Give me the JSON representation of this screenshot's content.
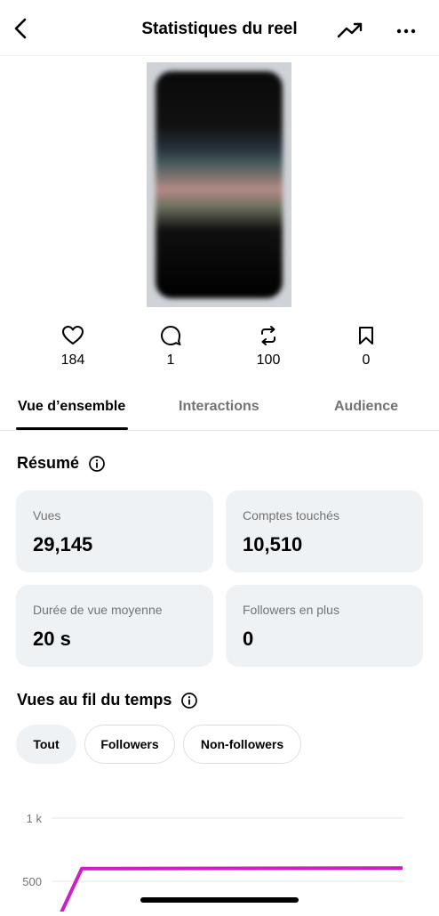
{
  "header": {
    "title": "Statistiques du reel",
    "back_icon": "chevron-left-icon",
    "trend_icon": "trending-up-icon",
    "more_icon": "more-horizontal-icon"
  },
  "thumbnail": {
    "alt": "blurred-reel-thumbnail"
  },
  "stats": [
    {
      "icon": "heart-icon",
      "value": "184"
    },
    {
      "icon": "comment-icon",
      "value": "1"
    },
    {
      "icon": "repost-icon",
      "value": "100"
    },
    {
      "icon": "bookmark-icon",
      "value": "0"
    }
  ],
  "tabs": [
    {
      "label": "Vue d’ensemble",
      "active": true
    },
    {
      "label": "Interactions",
      "active": false
    },
    {
      "label": "Audience",
      "active": false
    }
  ],
  "summary": {
    "title": "Résumé",
    "cards": [
      {
        "label": "Vues",
        "value": "29,145"
      },
      {
        "label": "Comptes touchés",
        "value": "10,510"
      },
      {
        "label": "Durée de vue moyenne",
        "value": "20 s"
      },
      {
        "label": "Followers en plus",
        "value": "0"
      }
    ]
  },
  "views_over_time": {
    "title": "Vues au fil du temps",
    "filters": [
      {
        "label": "Tout",
        "active": true
      },
      {
        "label": "Followers",
        "active": false
      },
      {
        "label": "Non-followers",
        "active": false
      }
    ]
  },
  "chart_data": {
    "type": "line",
    "y_tick_labels": [
      "1 k",
      "500"
    ],
    "y_ticks": [
      1000,
      500
    ],
    "ylim": [
      0,
      1000
    ],
    "series": [
      {
        "color": "#d21cc8",
        "x": [
          0,
          1,
          2
        ],
        "y": [
          0,
          600,
          605
        ]
      }
    ],
    "grid": true
  },
  "colors": {
    "accent": "#d21cc8",
    "card_bg": "#eff2f5",
    "muted": "#737373"
  }
}
